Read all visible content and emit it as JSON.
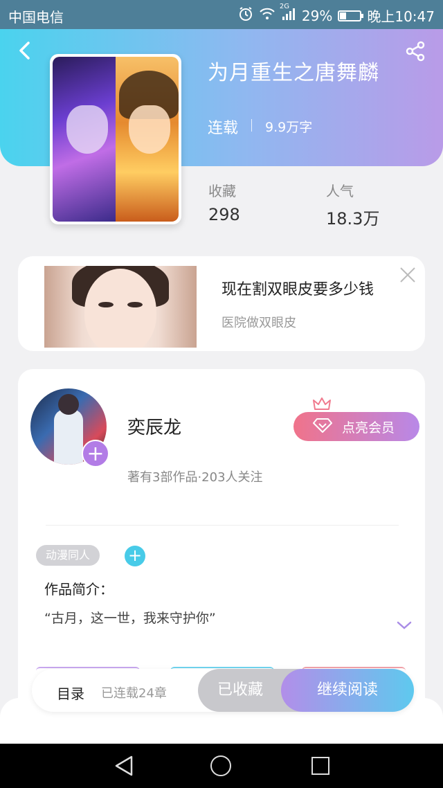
{
  "status_bar": {
    "carrier": "中国电信",
    "network": "2G",
    "battery": "29%",
    "time": "晚上10:47"
  },
  "book": {
    "title": "为月重生之唐舞麟",
    "status": "连载",
    "word_count": "9.9万字",
    "stats": [
      {
        "label": "收藏",
        "value": "298"
      },
      {
        "label": "人气",
        "value": "18.3万"
      }
    ]
  },
  "ad": {
    "title": "现在割双眼皮要多少钱",
    "subtitle": "医院做双眼皮"
  },
  "author": {
    "name": "奕辰龙",
    "meta": "著有3部作品·203人关注",
    "follow_icon": "+",
    "vip_label": "点亮会员"
  },
  "tags": {
    "items": [
      "动漫同人"
    ],
    "add_icon": "+"
  },
  "intro": {
    "title": "作品简介：",
    "text": "“古月，这一世，我来守护你”"
  },
  "bottom_bar": {
    "toc_label": "目录",
    "toc_count": "已连载24章",
    "collected_label": "已收藏",
    "continue_label": "继续阅读"
  },
  "colors": {
    "header_gradient_start": "#4ad3ee",
    "header_gradient_end": "#b99be8",
    "vip_pink": "#f0738a",
    "accent_purple": "#b27ce6",
    "accent_cyan": "#48cbe8"
  },
  "icons": [
    "back-icon",
    "share-icon",
    "close-icon",
    "diamond-icon",
    "crown-icon",
    "chevron-down-icon",
    "alarm-icon",
    "wifi-icon",
    "signal-icon",
    "battery-icon"
  ]
}
